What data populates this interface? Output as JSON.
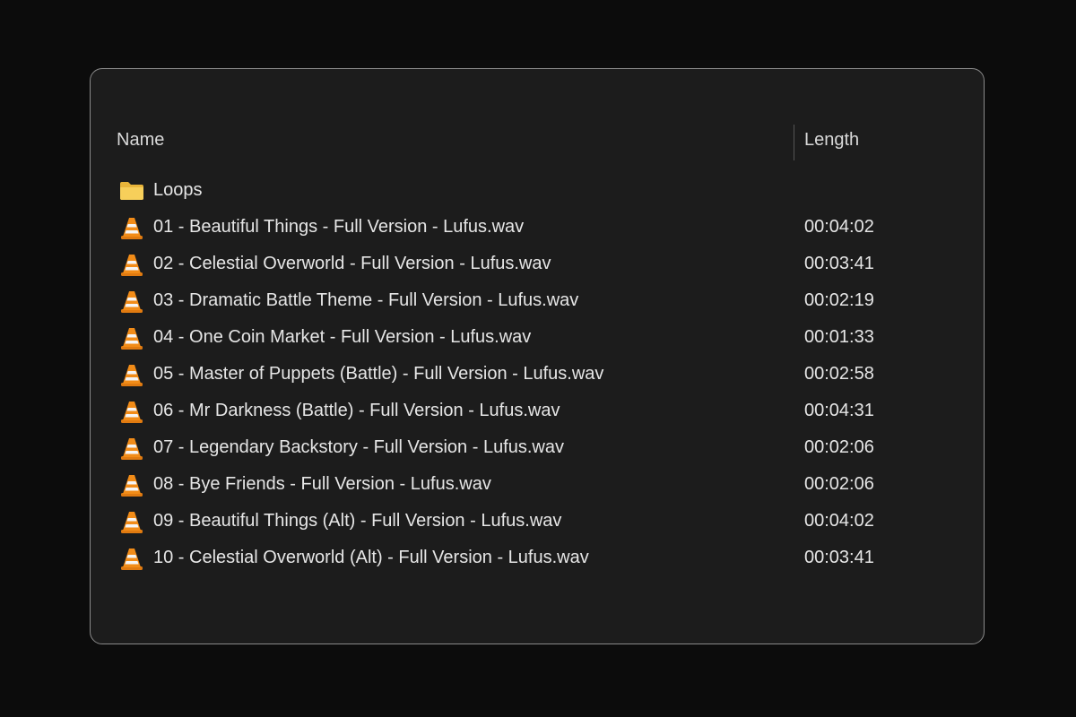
{
  "headers": {
    "name": "Name",
    "length": "Length"
  },
  "items": [
    {
      "type": "folder",
      "icon": "folder-icon",
      "name": "Loops",
      "length": ""
    },
    {
      "type": "file",
      "icon": "vlc-icon",
      "name": "01 - Beautiful Things - Full Version - Lufus.wav",
      "length": "00:04:02"
    },
    {
      "type": "file",
      "icon": "vlc-icon",
      "name": "02 - Celestial Overworld - Full Version - Lufus.wav",
      "length": "00:03:41"
    },
    {
      "type": "file",
      "icon": "vlc-icon",
      "name": "03 - Dramatic Battle Theme - Full Version - Lufus.wav",
      "length": "00:02:19"
    },
    {
      "type": "file",
      "icon": "vlc-icon",
      "name": "04 - One Coin Market - Full Version - Lufus.wav",
      "length": "00:01:33"
    },
    {
      "type": "file",
      "icon": "vlc-icon",
      "name": "05 - Master of Puppets (Battle) - Full Version - Lufus.wav",
      "length": "00:02:58"
    },
    {
      "type": "file",
      "icon": "vlc-icon",
      "name": "06 - Mr Darkness (Battle) - Full Version - Lufus.wav",
      "length": "00:04:31"
    },
    {
      "type": "file",
      "icon": "vlc-icon",
      "name": "07 - Legendary Backstory - Full Version - Lufus.wav",
      "length": "00:02:06"
    },
    {
      "type": "file",
      "icon": "vlc-icon",
      "name": "08 - Bye Friends - Full Version - Lufus.wav",
      "length": "00:02:06"
    },
    {
      "type": "file",
      "icon": "vlc-icon",
      "name": "09 - Beautiful Things (Alt) - Full Version - Lufus.wav",
      "length": "00:04:02"
    },
    {
      "type": "file",
      "icon": "vlc-icon",
      "name": "10 - Celestial Overworld (Alt) - Full Version - Lufus.wav",
      "length": "00:03:41"
    }
  ],
  "colors": {
    "background": "#0c0c0c",
    "panel": "#1c1c1c",
    "text": "#e6e6e6",
    "folder": "#f5c84c",
    "vlc_orange": "#f08a16"
  }
}
